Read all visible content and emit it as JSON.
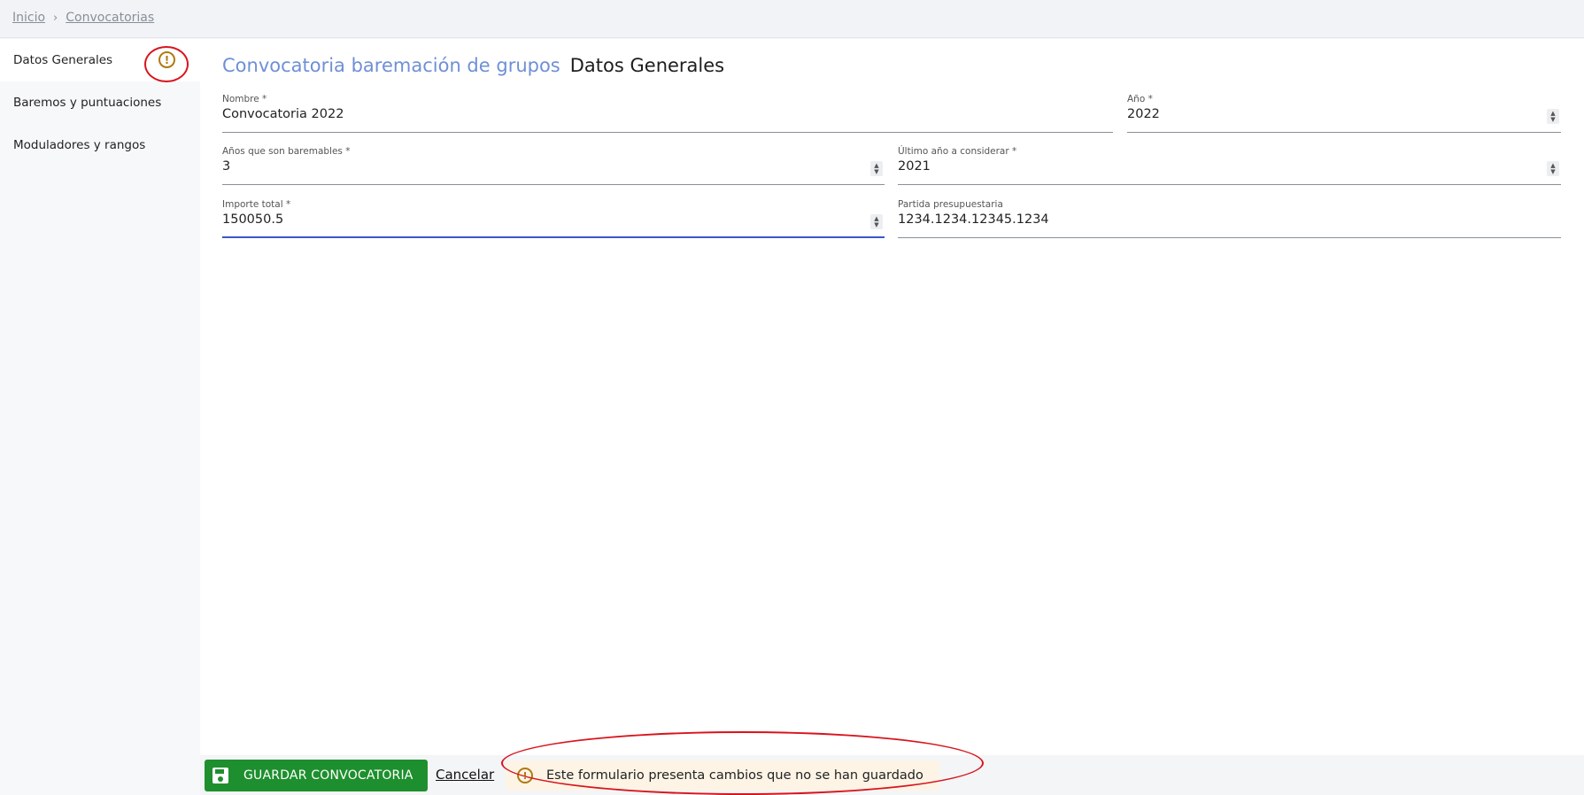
{
  "breadcrumb": {
    "items": [
      "Inicio",
      "Convocatorias"
    ],
    "separator": "›"
  },
  "sidebar": {
    "items": [
      {
        "label": "Datos Generales",
        "active": true,
        "badge": "!"
      },
      {
        "label": "Baremos y puntuaciones"
      },
      {
        "label": "Moduladores y rangos"
      }
    ]
  },
  "header": {
    "section": "Convocatoria baremación de grupos",
    "title": "Datos Generales"
  },
  "form": {
    "nombre": {
      "label": "Nombre *",
      "value": "Convocatoria 2022"
    },
    "anio": {
      "label": "Año *",
      "value": "2022"
    },
    "anios_baremables": {
      "label": "Años que son baremables *",
      "value": "3"
    },
    "ultimo_anio": {
      "label": "Último año a considerar *",
      "value": "2021"
    },
    "importe_total": {
      "label": "Importe total *",
      "value": "150050.5"
    },
    "partida": {
      "label": "Partida presupuestaria",
      "value": "1234.1234.12345.1234"
    }
  },
  "footer": {
    "save_label": "GUARDAR CONVOCATORIA",
    "cancel_label": "Cancelar",
    "unsaved_message": "Este formulario presenta cambios que no se han guardado"
  },
  "colors": {
    "accent": "#6f8fd6",
    "save": "#1e8f2e",
    "warning": "#b07a10",
    "annotation": "#d8141c",
    "focus": "#3b57c4"
  },
  "icons": {
    "warning": "exclamation-circle-icon",
    "save": "floppy-disk-icon",
    "spinner": "chevron-up-down-icon"
  }
}
